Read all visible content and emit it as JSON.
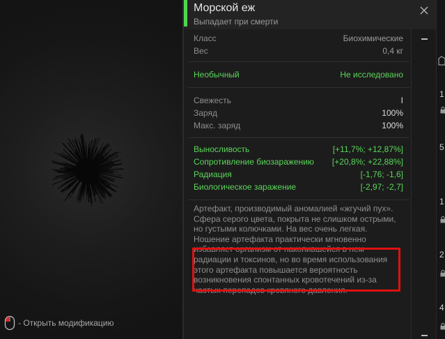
{
  "item": {
    "title": "Морской еж",
    "subtitle": "Выпадает при смерти"
  },
  "specs": [
    {
      "label": "Класс",
      "value": "Биохимические"
    },
    {
      "label": "Вес",
      "value": "0,4 кг"
    }
  ],
  "rarity": {
    "label": "Необычный",
    "value": "Не исследовано"
  },
  "condition": [
    {
      "label": "Свежесть",
      "value": "I"
    },
    {
      "label": "Заряд",
      "value": "100%"
    },
    {
      "label": "Макс. заряд",
      "value": "100%"
    }
  ],
  "effects": [
    {
      "label": "Выносливость",
      "value": "[+11,7%; +12,87%]"
    },
    {
      "label": "Сопротивление биозаражению",
      "value": "[+20,8%; +22,88%]"
    },
    {
      "label": "Радиация",
      "value": "[-1,76; -1,6]"
    },
    {
      "label": "Биологическое заражение",
      "value": "[-2,97; -2,7]"
    }
  ],
  "description": {
    "lines": [
      "Артефакт, производимый аномалией «жгучий пух».",
      "Сфера серого цвета, покрыта не слишком острыми,",
      "но густыми колючками. На вес очень легкая.",
      "Ношение артефакта практически мгновенно",
      "избавляет организм от накопившейся в нем",
      "радиации и токсинов, но во время использования",
      "этого артефакта повышается вероятность",
      "возникновения спонтанных кровотечений из-за",
      "частых перепадов кровяного давления."
    ]
  },
  "hint": {
    "text": "- Открыть модификацию"
  },
  "strip": {
    "items": [
      "1",
      "5",
      "1",
      "2",
      "4"
    ]
  },
  "colors": {
    "accent": "#4fd64f",
    "effect_green": "#5bd65b",
    "highlight": "#e01010"
  },
  "icons": {
    "close": "close-icon",
    "mouse": "mouse-icon",
    "lock": "lock-icon"
  }
}
